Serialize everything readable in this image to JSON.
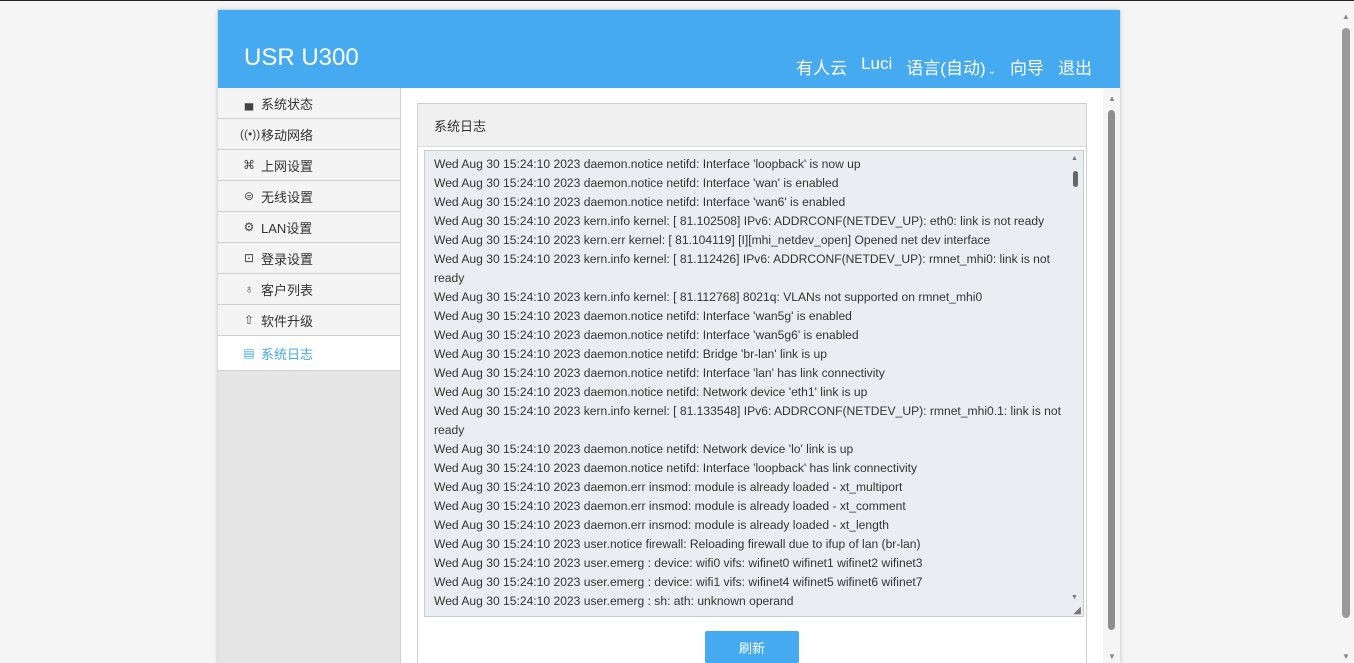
{
  "header": {
    "brand": "USR U300",
    "nav": {
      "cloud": "有人云",
      "luci": "Luci",
      "language": "语言(自动)",
      "wizard": "向导",
      "logout": "退出"
    }
  },
  "sidebar": {
    "items": [
      {
        "label": "系统状态",
        "icon": "router-icon"
      },
      {
        "label": "移动网络",
        "icon": "signal-icon"
      },
      {
        "label": "上网设置",
        "icon": "network-icon"
      },
      {
        "label": "无线设置",
        "icon": "wifi-icon"
      },
      {
        "label": "LAN设置",
        "icon": "lan-icon"
      },
      {
        "label": "登录设置",
        "icon": "login-icon"
      },
      {
        "label": "客户列表",
        "icon": "users-icon"
      },
      {
        "label": "软件升级",
        "icon": "upgrade-icon"
      },
      {
        "label": "系统日志",
        "icon": "log-icon"
      }
    ],
    "active_index": 8
  },
  "panel": {
    "title": "系统日志",
    "log_lines": [
      "Wed Aug 30 15:24:10 2023 daemon.notice netifd: Interface 'loopback' is now up",
      "Wed Aug 30 15:24:10 2023 daemon.notice netifd: Interface 'wan' is enabled",
      "Wed Aug 30 15:24:10 2023 daemon.notice netifd: Interface 'wan6' is enabled",
      "Wed Aug 30 15:24:10 2023 kern.info kernel: [   81.102508] IPv6: ADDRCONF(NETDEV_UP): eth0: link is not ready",
      "Wed Aug 30 15:24:10 2023 kern.err kernel: [   81.104119] [I][mhi_netdev_open] Opened net dev interface",
      "Wed Aug 30 15:24:10 2023 kern.info kernel: [   81.112426] IPv6: ADDRCONF(NETDEV_UP): rmnet_mhi0: link is not ready",
      "Wed Aug 30 15:24:10 2023 kern.info kernel: [   81.112768] 8021q: VLANs not supported on rmnet_mhi0",
      "Wed Aug 30 15:24:10 2023 daemon.notice netifd: Interface 'wan5g' is enabled",
      "Wed Aug 30 15:24:10 2023 daemon.notice netifd: Interface 'wan5g6' is enabled",
      "Wed Aug 30 15:24:10 2023 daemon.notice netifd: Bridge 'br-lan' link is up",
      "Wed Aug 30 15:24:10 2023 daemon.notice netifd: Interface 'lan' has link connectivity",
      "Wed Aug 30 15:24:10 2023 daemon.notice netifd: Network device 'eth1' link is up",
      "Wed Aug 30 15:24:10 2023 kern.info kernel: [   81.133548] IPv6: ADDRCONF(NETDEV_UP): rmnet_mhi0.1: link is not ready",
      "Wed Aug 30 15:24:10 2023 daemon.notice netifd: Network device 'lo' link is up",
      "Wed Aug 30 15:24:10 2023 daemon.notice netifd: Interface 'loopback' has link connectivity",
      "Wed Aug 30 15:24:10 2023 daemon.err insmod: module is already loaded - xt_multiport",
      "Wed Aug 30 15:24:10 2023 daemon.err insmod: module is already loaded - xt_comment",
      "Wed Aug 30 15:24:10 2023 daemon.err insmod: module is already loaded - xt_length",
      "Wed Aug 30 15:24:10 2023 user.notice firewall: Reloading firewall due to ifup of lan (br-lan)",
      "Wed Aug 30 15:24:10 2023 user.emerg : device: wifi0 vifs: wifinet0 wifinet1 wifinet2 wifinet3",
      "Wed Aug 30 15:24:10 2023 user.emerg : device: wifi1 vifs: wifinet4 wifinet5 wifinet6 wifinet7",
      "Wed Aug 30 15:24:10 2023 user.emerg : sh: ath: unknown operand"
    ],
    "refresh_label": "刷新"
  },
  "colors": {
    "accent": "#46aaf0"
  }
}
